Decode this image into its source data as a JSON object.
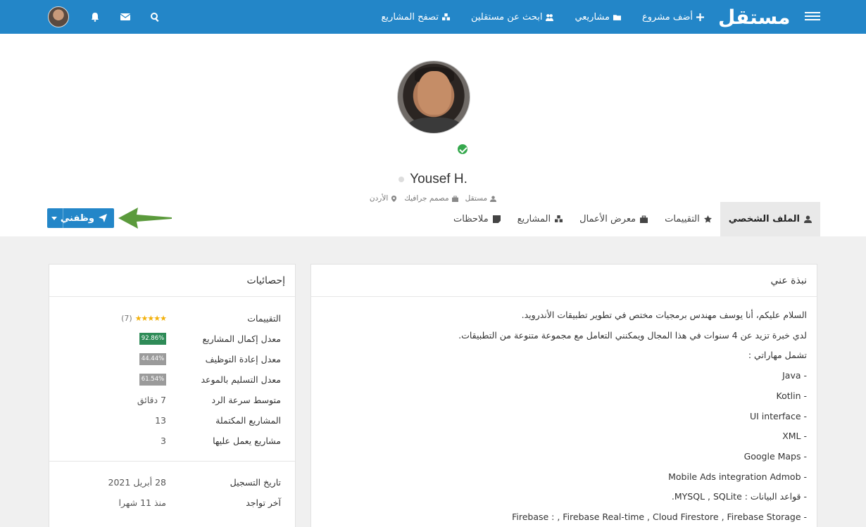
{
  "nav": {
    "logo": "مستقل",
    "links": [
      {
        "label": "أضف مشروع",
        "icon": "plus-icon"
      },
      {
        "label": "مشاريعي",
        "icon": "folder-icon"
      },
      {
        "label": "ابحث عن مستقلين",
        "icon": "users-icon"
      },
      {
        "label": "تصفح المشاريع",
        "icon": "cubes-icon"
      }
    ],
    "right_icons": [
      "menu-icon"
    ],
    "left_icons": [
      "search-icon",
      "envelope-icon",
      "bell-icon",
      "avatar"
    ]
  },
  "profile": {
    "name": "Yousef H.",
    "meta": [
      {
        "label": "مستقل",
        "icon": "user-icon"
      },
      {
        "label": "مصمم جرافيك",
        "icon": "briefcase-icon"
      },
      {
        "label": "الأردن",
        "icon": "map-pin-icon"
      }
    ]
  },
  "tabs": [
    {
      "label": "الملف الشخصي",
      "icon": "user-icon",
      "active": true
    },
    {
      "label": "التقييمات",
      "icon": "star-icon",
      "active": false
    },
    {
      "label": "معرض الأعمال",
      "icon": "briefcase-icon",
      "active": false
    },
    {
      "label": "المشاريع",
      "icon": "cubes-icon",
      "active": false
    },
    {
      "label": "ملاحظات",
      "icon": "note-icon",
      "active": false
    }
  ],
  "hire_button": {
    "label": "وظفني"
  },
  "about": {
    "title": "نبذة عني",
    "lines": [
      "السلام عليكم، أنا يوسف مهندس برمجيات مختص في تطوير تطبيقات الأندرويد.",
      "لدي خبرة تزيد عن 4 سنوات في هذا المجال ويمكنني التعامل مع مجموعة متنوعة من التطبيقات.",
      "تشمل مهاراتي :",
      "- Java",
      "- Kotlin",
      "- UI interface",
      "-  XML",
      "- Google Maps",
      "- Mobile Ads integration Admob",
      "- قواعد البيانات : MYSQL , SQLite.",
      "- Firebase : , Firebase Real-time , Cloud Firestore , Firebase Storage"
    ]
  },
  "stats": {
    "title": "إحصائيات",
    "rating_label": "التقييمات",
    "rating_stars": "★★★★★",
    "rating_count": "(7)",
    "rows": [
      {
        "key": "معدل إكمال المشاريع",
        "value": "92.86%",
        "pill": "green"
      },
      {
        "key": "معدل إعادة التوظيف",
        "value": "44.44%",
        "pill": "gray"
      },
      {
        "key": "معدل التسليم بالموعد",
        "value": "61.54%",
        "pill": "gray"
      },
      {
        "key": "متوسط سرعة الرد",
        "value": "7 دقائق"
      },
      {
        "key": "المشاريع المكتملة",
        "value": "13"
      },
      {
        "key": "مشاريع يعمل عليها",
        "value": "3"
      }
    ],
    "dates": [
      {
        "key": "تاريخ التسجيل",
        "value": "28 أبريل 2021"
      },
      {
        "key": "آخر تواجد",
        "value": "منذ 11 شهرا"
      }
    ]
  },
  "colors": {
    "primary": "#2386c8",
    "success": "#2e8b57",
    "arrow": "#5b9a3c"
  }
}
